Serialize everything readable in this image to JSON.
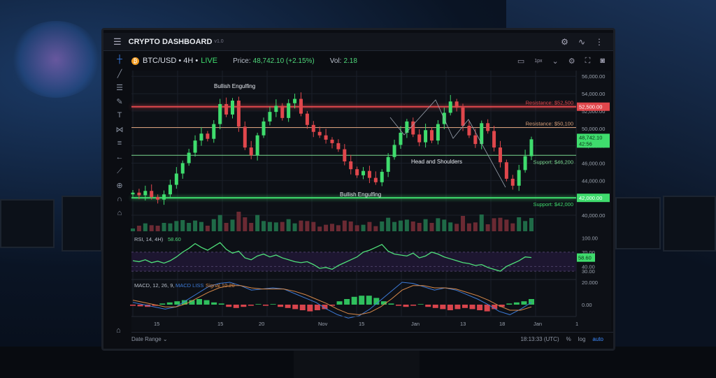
{
  "app": {
    "title": "CRYPTO DASHBOARD",
    "version": "v1.0"
  },
  "header_icons": [
    "gear-icon",
    "pulse-icon",
    "more-vertical-icon"
  ],
  "ticker": {
    "coin_glyph": "₿",
    "symbol": "BTC/USD • 4H •",
    "live": "LIVE",
    "price_label": "Price:",
    "price": "48,742.10 (+2.15%)",
    "vol_label": "Vol:",
    "vol": "2.18",
    "resolution": "1px"
  },
  "left_tools": [
    "crosshair-icon",
    "trendline-icon",
    "parallel-lines-icon",
    "brush-icon",
    "text-icon",
    "pattern-icon",
    "fib-icon",
    "arrow-left-icon",
    "ruler-icon",
    "zoom-icon",
    "magnet-icon",
    "lock-icon"
  ],
  "price_axis": {
    "ticks": [
      "56,000.00",
      "54,000.00",
      "52,000.00",
      "50,000.00",
      "48,000.00",
      "46,000.00",
      "44,000.00",
      "42,000.00",
      "40,000.00"
    ],
    "tick_values": [
      56000,
      54000,
      52000,
      50000,
      48000,
      46000,
      44000,
      42000,
      40000
    ],
    "min": 39600,
    "max": 56500
  },
  "levels": [
    {
      "label": "Resistance: $52,500",
      "value": 52500,
      "tag": "52,500.00",
      "color": "#e0474c",
      "strong": true
    },
    {
      "label": "Resistance: $50,100",
      "value": 50100,
      "tag": "",
      "color": "#d9a07a",
      "strong": false
    },
    {
      "label": "Support: $46,200",
      "value": 46900,
      "tag": "",
      "color": "#7bd88f",
      "strong": false
    },
    {
      "label": "Support: $42,000",
      "value": 42000,
      "tag": "42,000.00",
      "color": "#3fdc6d",
      "strong": true
    }
  ],
  "current_tag": {
    "price": "48,742.10",
    "countdown": "42:56",
    "value": 48742
  },
  "annotations": {
    "bullish_top": "Bullish Engulfing",
    "bullish_bottom": "Bullish Engulfing",
    "head_shoulders": "Head and Shoulders"
  },
  "closes": [
    42600,
    42300,
    42800,
    42100,
    41800,
    42400,
    43500,
    44800,
    46000,
    47200,
    48600,
    49400,
    48800,
    50500,
    52800,
    51600,
    53200,
    50200,
    47800,
    46900,
    49200,
    50800,
    51900,
    52600,
    51200,
    52900,
    53400,
    51700,
    50400,
    49600,
    49200,
    48700,
    48300,
    47600,
    46200,
    45300,
    44600,
    45100,
    44300,
    43800,
    45000,
    46700,
    48100,
    49500,
    50800,
    49300,
    48400,
    49800,
    48600,
    50500,
    51800,
    53100,
    52400,
    50300,
    49200,
    48200,
    50600,
    49700,
    47800,
    46100,
    44200,
    43400,
    45200,
    46800,
    48742
  ],
  "rsi": {
    "label": "RSI, 14, 4H)",
    "value": "58.60",
    "ticks": [
      "100.00",
      "70.00",
      "40.00",
      "30.00"
    ],
    "tick_values": [
      100,
      70,
      40,
      30
    ],
    "values": [
      52,
      50,
      54,
      48,
      51,
      47,
      52,
      60,
      70,
      78,
      88,
      80,
      74,
      82,
      90,
      76,
      68,
      72,
      58,
      54,
      62,
      66,
      60,
      64,
      58,
      54,
      50,
      48,
      50,
      44,
      36,
      38,
      34,
      42,
      48,
      54,
      60,
      70,
      74,
      80,
      86,
      72,
      66,
      64,
      62,
      68,
      58,
      62,
      70,
      66,
      60,
      56,
      52,
      48,
      46,
      42,
      44,
      38,
      34,
      30,
      40,
      46,
      52,
      60,
      58.6
    ]
  },
  "macd": {
    "label": "MACD, 12, 26, 9,",
    "macd_label": "MACD LISS",
    "signal_label": "Signal 10.20",
    "ticks": [
      "20.000",
      "0.00"
    ],
    "tick_values": [
      20,
      0
    ],
    "hist": [
      -1,
      -1.5,
      -2,
      -1,
      1,
      2,
      3,
      4,
      4,
      5,
      4,
      2,
      1,
      -2,
      -3,
      -2,
      -1,
      0.5,
      -1,
      0.5,
      -2,
      -3,
      -4,
      -5,
      -6,
      -5,
      -4,
      -1,
      3,
      5,
      7,
      8,
      8,
      6,
      3,
      1,
      -1,
      -2,
      -1,
      0.5,
      -2,
      -3,
      -4,
      -5,
      -4,
      -3,
      -4,
      -5,
      -6,
      -4,
      -2,
      1,
      2,
      3,
      5
    ],
    "macd_line": [
      2,
      0,
      -2,
      -4,
      -2,
      4,
      10,
      16,
      19,
      20,
      17,
      13,
      14,
      15,
      14,
      10,
      6,
      2,
      -4,
      -9,
      -12,
      -10,
      -4,
      4,
      12,
      20,
      19,
      16,
      13,
      15,
      13,
      9,
      5,
      0,
      -6,
      -9,
      -4,
      2
    ],
    "signal_line": [
      4,
      2,
      0,
      -2,
      -2,
      1,
      6,
      11,
      15,
      17,
      17,
      15,
      14,
      14,
      14,
      12,
      9,
      5,
      1,
      -4,
      -8,
      -9,
      -7,
      -2,
      5,
      13,
      17,
      17,
      15,
      15,
      14,
      11,
      8,
      4,
      -1,
      -5,
      -5,
      -2
    ]
  },
  "x_axis": [
    "15",
    "15",
    "20",
    "Nov",
    "15",
    "Jan",
    "13",
    "18",
    "Jan",
    "1"
  ],
  "footer": {
    "date_range": "Date Range ⌄",
    "time": "18:13:33 (UTC)",
    "percent": "%",
    "log": "log",
    "auto": "auto"
  }
}
